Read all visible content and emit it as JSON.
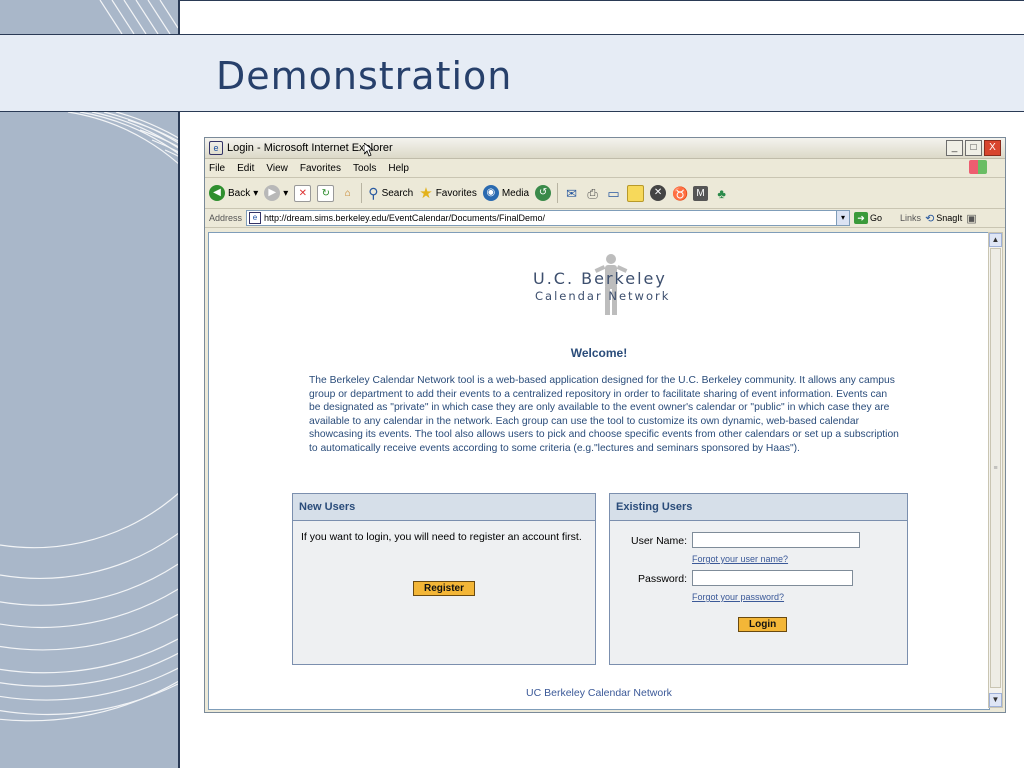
{
  "slide": {
    "title": "Demonstration"
  },
  "window": {
    "title": "Login - Microsoft Internet Explorer",
    "buttons": {
      "minimize": "_",
      "maximize": "□",
      "close": "X"
    }
  },
  "menu": [
    "File",
    "Edit",
    "View",
    "Favorites",
    "Tools",
    "Help"
  ],
  "toolbar": {
    "back": "Back",
    "search": "Search",
    "favorites": "Favorites",
    "media": "Media"
  },
  "address": {
    "label": "Address",
    "url": "http://dream.sims.berkeley.edu/EventCalendar/Documents/FinalDemo/",
    "go": "Go",
    "links": "Links",
    "snagit": "SnagIt"
  },
  "page": {
    "logo_line1": "U.C. Berkeley",
    "logo_line2": "Calendar Network",
    "welcome": "Welcome!",
    "intro": "The Berkeley Calendar Network tool is a web-based application designed for the U.C. Berkeley community. It allows any campus group or department to add their events to a centralized repository in order to facilitate sharing of event information. Events can be designated as \"private\" in which case they are only available to the event owner's calendar or \"public\" in which case they are available to any calendar in the network. Each group can use the tool to customize its own dynamic, web-based calendar showcasing its events. The tool also allows users to pick and choose specific events from other calendars or set up a subscription to automatically receive events according to some criteria (e.g.\"lectures and seminars sponsored by Haas\").",
    "new_users": {
      "heading": "New Users",
      "text": "If you want to login, you will need to register an account first.",
      "register_label": "Register"
    },
    "existing_users": {
      "heading": "Existing Users",
      "username_label": "User Name:",
      "username_value": "",
      "forgot_username": "Forgot your user name?",
      "password_label": "Password:",
      "password_value": "",
      "forgot_password": "Forgot your password?",
      "login_label": "Login"
    },
    "footer": "UC Berkeley Calendar Network"
  }
}
